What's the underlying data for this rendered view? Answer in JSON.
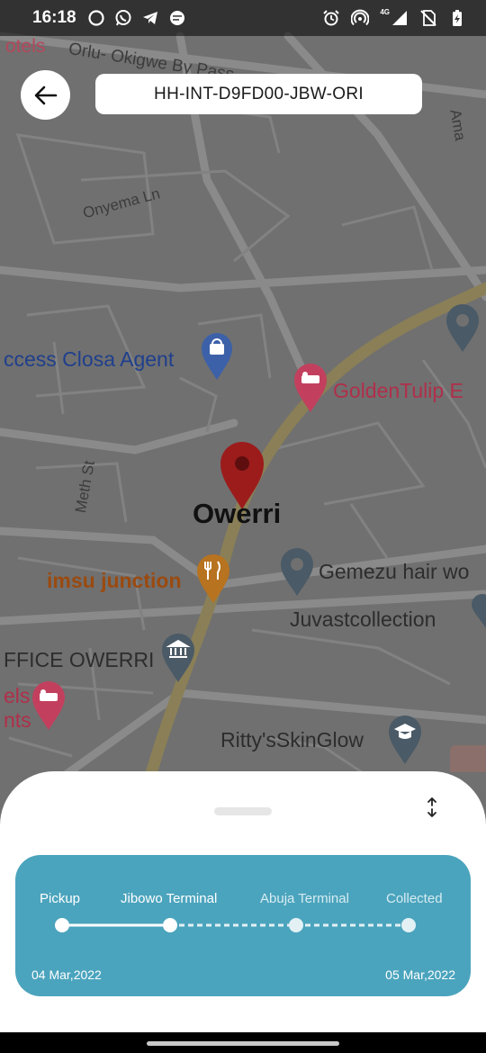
{
  "status_bar": {
    "time": "16:18",
    "left_icons": [
      "circle-icon",
      "whatsapp-icon",
      "telegram-icon",
      "message-icon"
    ],
    "right_icons": [
      "alarm-icon",
      "hotspot-icon",
      "signal-4g-icon",
      "no-sim-icon",
      "battery-charging-icon"
    ],
    "network_label": "4G"
  },
  "header": {
    "tracking_id": "HH-INT-D9FD00-JBW-ORI"
  },
  "map": {
    "city": "Owerri",
    "roads": [
      "Orlu- Okigwe By Pass",
      "Onyema Ln",
      "Meth St"
    ],
    "edge_labels": [
      "otels",
      "Ama"
    ],
    "pois": {
      "access_closa": "ccess Closa Agent",
      "golden_tulip": "GoldenTulip E",
      "imsu_junction": "imsu junction",
      "gemezu": "Gemezu hair wo",
      "juvast": "Juvastcollection",
      "office": "FFICE OWERRI",
      "els": "els",
      "nts": "nts",
      "ritty": "Ritty'sSkinGlow"
    }
  },
  "tracking": {
    "accent_color": "#4ba4bd",
    "stages": [
      {
        "label": "Pickup",
        "status": "done"
      },
      {
        "label": "Jibowo Terminal",
        "status": "done"
      },
      {
        "label": "Abuja Terminal",
        "status": "pending"
      },
      {
        "label": "Collected",
        "status": "pending"
      }
    ],
    "start_date": "04 Mar,2022",
    "end_date": "05 Mar,2022"
  }
}
